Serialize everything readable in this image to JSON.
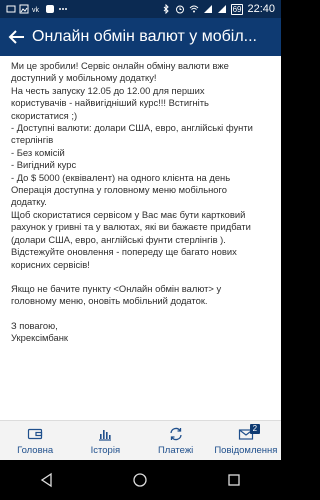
{
  "status_bar": {
    "battery": "69",
    "time": "22:40"
  },
  "header": {
    "title": "Онлайн обмін валют у мобіл..."
  },
  "message": {
    "lines": [
      "Ми це зробили! Сервіс онлайн обміну валюти вже",
      "доступний у мобільному додатку!",
      "На честь запуску 12.05 до 12.00 для перших",
      "користувачів - найвигідніший курс!!! Встигніть",
      "скористатися ;)",
      "- Доступні валюти: долари США, евро, англійські фунти",
      "стерлінгів",
      "- Без комісій",
      "- Вигідний курс",
      "- До $ 5000 (еквівалент) на одного клієнта на день",
      "Операція доступна у головному меню мобільного",
      "додатку.",
      "Щоб скористатися сервісом у Вас має бути картковий",
      "рахунок у гривні та у валютах, які ви бажаєте придбати",
      "(долари США, евро, англійські фунти стерлінгів ).",
      "Відстежуйте оновлення - попереду ще багато нових",
      "корисних сервісів!"
    ],
    "paragraph2": [
      "Якщо не бачите пункту <Онлайн обмін валют> у",
      "головному меню, оновіть мобільний додаток."
    ],
    "signoff": [
      "З повагою,",
      "Укрексімбанк"
    ]
  },
  "bottom_nav": {
    "items": [
      {
        "label": "Головна",
        "icon": "wallet-icon"
      },
      {
        "label": "Історія",
        "icon": "bar-chart-icon"
      },
      {
        "label": "Платежі",
        "icon": "refresh-icon"
      },
      {
        "label": "Повідомлення",
        "icon": "envelope-icon",
        "badge": "2"
      }
    ]
  },
  "colors": {
    "app_bar": "#0e3a72",
    "status_bar": "#0b2a52",
    "accent": "#1f4f8c"
  }
}
